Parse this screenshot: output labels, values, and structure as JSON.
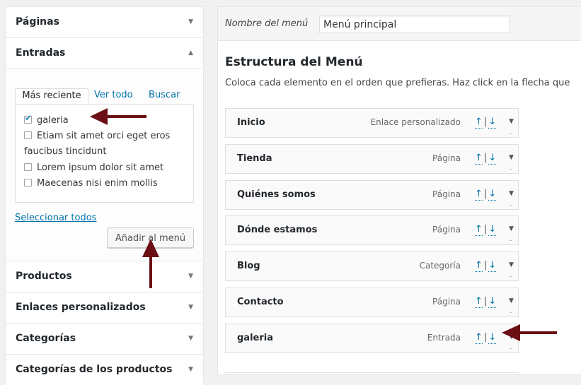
{
  "left_panel": {
    "sections_top": [
      {
        "label": "Páginas",
        "expanded": false
      }
    ],
    "open_section": {
      "label": "Entradas",
      "tabs": [
        {
          "label": "Más reciente",
          "active": true
        },
        {
          "label": "Ver todo",
          "active": false
        },
        {
          "label": "Buscar",
          "active": false
        }
      ],
      "posts": [
        {
          "label": "galeria",
          "checked": true
        },
        {
          "label": "Etiam sit amet orci eget eros faucibus tincidunt",
          "checked": false
        },
        {
          "label": "Lorem ipsum dolor sit amet",
          "checked": false
        },
        {
          "label": "Maecenas nisi enim mollis",
          "checked": false
        }
      ],
      "select_all": "Seleccionar todos",
      "add_button": "Añadir al menú"
    },
    "sections_bottom": [
      {
        "label": "Productos",
        "expanded": false
      },
      {
        "label": "Enlaces personalizados",
        "expanded": false
      },
      {
        "label": "Categorías",
        "expanded": false
      },
      {
        "label": "Categorías de los productos",
        "expanded": false
      }
    ]
  },
  "right_panel": {
    "menu_name_label": "Nombre del menú",
    "menu_name_value": "Menú principal",
    "structure_title": "Estructura del Menú",
    "structure_desc": "Coloca cada elemento en el orden que prefieras. Haz click en la flecha que",
    "menu_items": [
      {
        "title": "Inicio",
        "type": "Enlace personalizado"
      },
      {
        "title": "Tienda",
        "type": "Página"
      },
      {
        "title": "Quiénes somos",
        "type": "Página"
      },
      {
        "title": "Dónde estamos",
        "type": "Página"
      },
      {
        "title": "Blog",
        "type": "Categoría"
      },
      {
        "title": "Contacto",
        "type": "Página"
      },
      {
        "title": "galeria",
        "type": "Entrada"
      }
    ],
    "move_up_glyph": "↑",
    "separator_glyph": "|",
    "move_down_glyph": "↓"
  },
  "icons": {
    "collapsed_arrow": "caret-down-icon",
    "expanded_arrow": "caret-up-icon",
    "checkbox_check": "checkmark-icon",
    "annotation_arrow_color": "#6b0f14"
  },
  "colors": {
    "link": "#0073aa",
    "background": "#f1f1f1",
    "annotation": "#6b0f14"
  }
}
